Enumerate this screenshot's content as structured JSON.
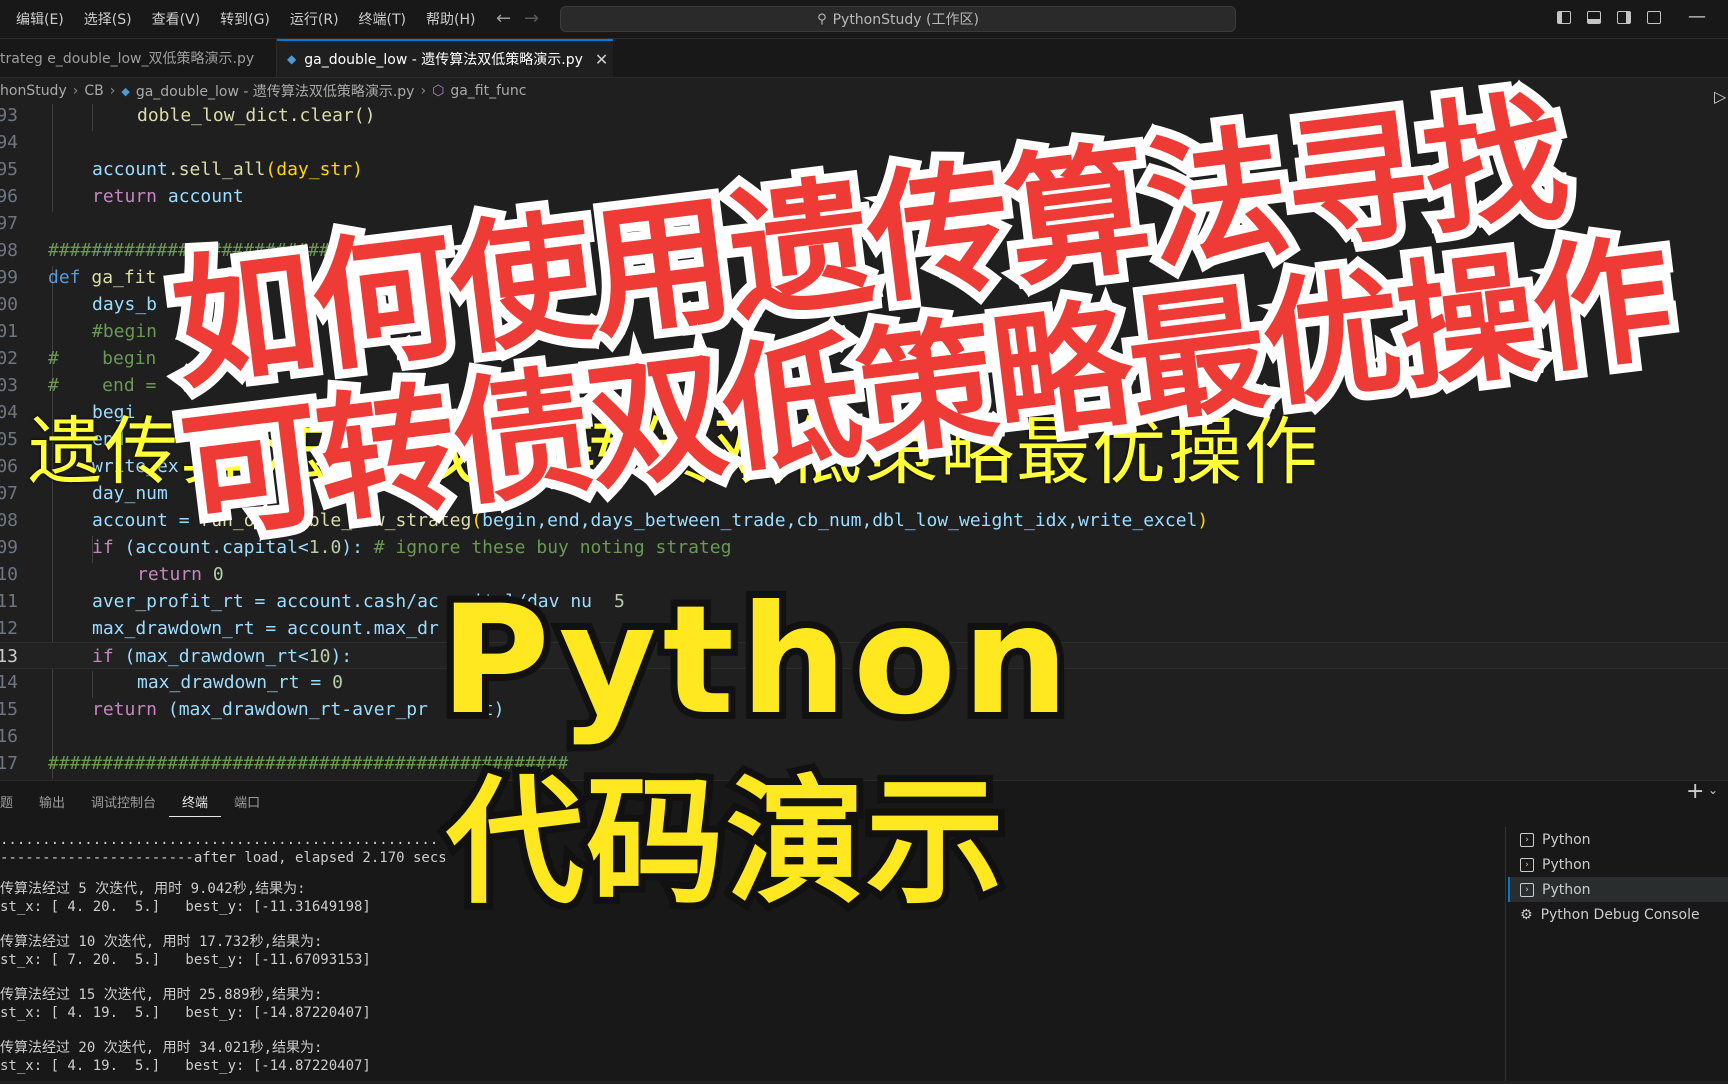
{
  "menu": [
    "编辑(E)",
    "选择(S)",
    "查看(V)",
    "转到(G)",
    "运行(R)",
    "终端(T)",
    "帮助(H)"
  ],
  "command_center": "PythonStudy (工作区)",
  "tabs": [
    {
      "label": "trateg e_double_low_双低策略演示.py"
    },
    {
      "label": "ga_double_low - 遗传算法双低策略演示.py"
    }
  ],
  "breadcrumb": [
    "honStudy",
    "CB",
    "ga_double_low - 遗传算法双低策略演示.py",
    "ga_fit_func"
  ],
  "editor": {
    "line_numbers": [
      "93",
      "94",
      "95",
      "96",
      "97",
      "98",
      "99",
      "00",
      "01",
      "02",
      "03",
      "04",
      "05",
      "06",
      "07",
      "08",
      "09",
      "10",
      "11",
      "12",
      "13",
      "14",
      "15",
      "16",
      "17"
    ],
    "current_line": "13"
  },
  "code": {
    "l93": "doble_low_dict.clear()",
    "l95a": "account",
    "l95b": ".sell_all",
    "l95c": "(day_str)",
    "l96a": "return",
    "l96b": " account",
    "l98": "##############################",
    "l99a": "def",
    "l99b": " ga_fit",
    "l00": "days_b",
    "l01": "#begin",
    "l02": "#    begin",
    "l03": "#    end =",
    "l04": "begi",
    "l05": "end",
    "l06": "write_ex",
    "l07": "day_num",
    "l08a": "account = ",
    "l08b": "run_one_doble_low_strateg",
    "l08c": "(",
    "l08d": "begin,end,days_between_trade,cb_num,dbl_low_weight_idx,write_excel",
    "l08e": ")",
    "l09a": "if",
    "l09b": " (account.capital<",
    "l09c": "1.0",
    "l09d": "): ",
    "l09e": "# ignore these buy noting strateg",
    "l10a": "return",
    "l10b": " 0",
    "l11": "aver_profit_rt = account.cash/ac",
    "l11b": "ital/dav nu",
    "l11c": "5",
    "l12": "max_drawdown_rt = account.max_dr",
    "l13a": "if",
    "l13b": " (max_drawdown_rt<",
    "l13c": "10",
    "l13d": "):",
    "l14a": "max_drawdown_rt = ",
    "l14b": "0",
    "l15a": "return",
    "l15b": " (max_drawdown_rt-aver_pr",
    "l15c": "rt)",
    "l17": "################################################"
  },
  "panel": {
    "tabs": [
      "题",
      "输出",
      "调试控制台",
      "终端",
      "端口"
    ],
    "active_tab": "终端",
    "terminal_lines": [
      "....................................................",
      "-----------------------after load, elapsed 2.170 secs",
      "传算法经过 5 次迭代, 用时 9.042秒,结果为:",
      "st_x: [ 4. 20.  5.]   best_y: [-11.31649198]",
      "传算法经过 10 次迭代, 用时 17.732秒,结果为:",
      "st_x: [ 7. 20.  5.]   best_y: [-11.67093153]",
      "传算法经过 15 次迭代, 用时 25.889秒,结果为:",
      "st_x: [ 4. 19.  5.]   best_y: [-14.87220407]",
      "传算法经过 20 次迭代, 用时 34.021秒,结果为:",
      "st_x: [ 4. 19.  5.]   best_y: [-14.87220407]"
    ],
    "terminals": [
      "Python",
      "Python",
      "Python",
      "Python Debug Console"
    ],
    "active_terminal_index": 2
  },
  "overlay": {
    "thin_line": "遗传算法寻找可转债双低策略最优操作",
    "red_line1": "如何使用遗传算法寻找",
    "red_line2": "可转债双低策略最优操作",
    "yellow_line1": "Python",
    "yellow_line2": "代码演示"
  },
  "colors": {
    "accent": "#0078d4",
    "red_title": "#ef3b36",
    "yellow_title": "#ffe81f"
  }
}
